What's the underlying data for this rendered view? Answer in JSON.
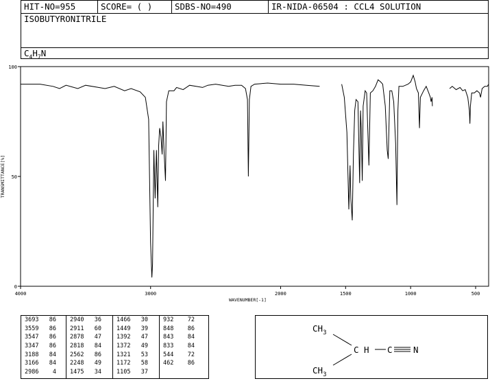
{
  "header": {
    "hit_no": "HIT-NO=955",
    "score": "SCORE=  (   )",
    "sdbs_no": "SDBS-NO=490",
    "source": "IR-NIDA-06504 : CCL4 SOLUTION",
    "compound_name": "ISOBUTYRONITRILE",
    "formula": {
      "c": "C",
      "c_sub": "4",
      "h": "H",
      "h_sub": "7",
      "n": "N"
    }
  },
  "chart_data": {
    "type": "line",
    "title": "",
    "xlabel": "WAVENUMBER[-1]",
    "ylabel": "TRANSMITTANCE[%]",
    "xlim": [
      4000,
      400
    ],
    "ylim": [
      0,
      100
    ],
    "x_ticks": [
      "4000",
      "3000",
      "2000",
      "1500",
      "1000",
      "500"
    ],
    "y_ticks": [
      "100",
      "50",
      "0"
    ],
    "series": [
      {
        "segments": [
          [
            [
              4000,
              92
            ],
            [
              3850,
              92
            ],
            [
              3750,
              91
            ],
            [
              3700,
              90
            ],
            [
              3650,
              91.5
            ],
            [
              3560,
              90
            ],
            [
              3500,
              91.5
            ],
            [
              3400,
              90.5
            ],
            [
              3350,
              90
            ],
            [
              3280,
              91
            ],
            [
              3200,
              89
            ],
            [
              3150,
              90
            ],
            [
              3080,
              88.5
            ],
            [
              3040,
              86
            ],
            [
              3015,
              76
            ],
            [
              3000,
              20
            ],
            [
              2990,
              4
            ],
            [
              2985,
              10
            ],
            [
              2975,
              62
            ],
            [
              2965,
              40
            ],
            [
              2955,
              62
            ],
            [
              2945,
              36
            ],
            [
              2938,
              64
            ],
            [
              2930,
              72
            ],
            [
              2920,
              68
            ],
            [
              2911,
              60
            ],
            [
              2905,
              75
            ],
            [
              2895,
              60
            ],
            [
              2885,
              48
            ],
            [
              2878,
              84
            ],
            [
              2860,
              89
            ],
            [
              2820,
              89
            ],
            [
              2800,
              90.5
            ],
            [
              2750,
              89.5
            ],
            [
              2700,
              91.5
            ],
            [
              2650,
              91
            ],
            [
              2600,
              90.5
            ],
            [
              2560,
              91.5
            ],
            [
              2500,
              92
            ],
            [
              2400,
              91
            ],
            [
              2350,
              91.5
            ],
            [
              2300,
              91.5
            ],
            [
              2270,
              90
            ],
            [
              2255,
              85
            ],
            [
              2248,
              50
            ],
            [
              2240,
              85
            ],
            [
              2228,
              91
            ],
            [
              2200,
              92
            ],
            [
              2100,
              92.5
            ],
            [
              2000,
              92
            ],
            [
              1900,
              92
            ],
            [
              1800,
              91.5
            ],
            [
              1700,
              91
            ]
          ],
          [
            [
              1530,
              92
            ],
            [
              1510,
              86
            ],
            [
              1490,
              70
            ],
            [
              1475,
              35
            ],
            [
              1466,
              55
            ],
            [
              1460,
              40
            ],
            [
              1449,
              30
            ],
            [
              1440,
              60
            ],
            [
              1430,
              80
            ],
            [
              1420,
              85
            ],
            [
              1405,
              84
            ],
            [
              1392,
              47
            ],
            [
              1385,
              80
            ],
            [
              1380,
              72
            ],
            [
              1372,
              48
            ],
            [
              1365,
              82
            ],
            [
              1350,
              89
            ],
            [
              1338,
              88
            ],
            [
              1321,
              55
            ],
            [
              1310,
              88
            ],
            [
              1290,
              89
            ],
            [
              1270,
              91
            ],
            [
              1250,
              94
            ],
            [
              1230,
              93
            ],
            [
              1215,
              92
            ],
            [
              1195,
              82
            ],
            [
              1180,
              62
            ],
            [
              1172,
              58
            ],
            [
              1160,
              89
            ],
            [
              1145,
              89
            ],
            [
              1130,
              84
            ],
            [
              1115,
              65
            ],
            [
              1105,
              37
            ],
            [
              1098,
              80
            ],
            [
              1090,
              91
            ],
            [
              1060,
              91
            ],
            [
              1020,
              92
            ],
            [
              1000,
              93
            ],
            [
              980,
              96
            ],
            [
              965,
              93
            ],
            [
              955,
              90
            ],
            [
              940,
              88
            ],
            [
              932,
              72
            ],
            [
              925,
              86
            ],
            [
              900,
              89
            ],
            [
              880,
              91
            ],
            [
              860,
              88
            ],
            [
              848,
              86
            ],
            [
              843,
              84
            ],
            [
              835,
              86
            ],
            [
              833,
              82
            ]
          ],
          [
            [
              700,
              90
            ],
            [
              680,
              91
            ],
            [
              650,
              89.5
            ],
            [
              620,
              90.5
            ],
            [
              600,
              89
            ],
            [
              580,
              89.5
            ],
            [
              560,
              86
            ],
            [
              548,
              80
            ],
            [
              544,
              74
            ],
            [
              540,
              82
            ],
            [
              530,
              88
            ],
            [
              510,
              88
            ],
            [
              490,
              89
            ],
            [
              470,
              88
            ],
            [
              462,
              86
            ],
            [
              450,
              90
            ],
            [
              430,
              91
            ],
            [
              410,
              91
            ],
            [
              400,
              92
            ]
          ]
        ]
      }
    ],
    "grid": false,
    "legend": "none"
  },
  "peak_table": {
    "columns": [
      [
        [
          "3693",
          "86"
        ],
        [
          "3559",
          "86"
        ],
        [
          "3547",
          "86"
        ],
        [
          "3347",
          "86"
        ],
        [
          "3188",
          "84"
        ],
        [
          "3166",
          "84"
        ],
        [
          "2986",
          "4"
        ]
      ],
      [
        [
          "2940",
          "36"
        ],
        [
          "2911",
          "60"
        ],
        [
          "2878",
          "47"
        ],
        [
          "2818",
          "84"
        ],
        [
          "2562",
          "86"
        ],
        [
          "2248",
          "49"
        ],
        [
          "1475",
          "34"
        ]
      ],
      [
        [
          "1466",
          "30"
        ],
        [
          "1449",
          "39"
        ],
        [
          "1392",
          "47"
        ],
        [
          "1372",
          "49"
        ],
        [
          "1321",
          "53"
        ],
        [
          "1172",
          "58"
        ],
        [
          "1105",
          "37"
        ]
      ],
      [
        [
          "932",
          "72"
        ],
        [
          "848",
          "86"
        ],
        [
          "843",
          "84"
        ],
        [
          "833",
          "84"
        ],
        [
          "544",
          "72"
        ],
        [
          "462",
          "86"
        ]
      ]
    ]
  },
  "structure": {
    "ch3_top": "CH",
    "ch3_top_sub": "3",
    "ch": "C H",
    "c_nitrile": "C",
    "n_nitrile": "N",
    "ch3_bottom": "CH",
    "ch3_bottom_sub": "3"
  }
}
